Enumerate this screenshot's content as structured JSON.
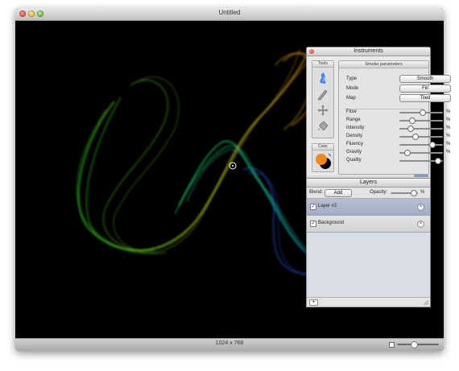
{
  "window": {
    "title": "Untitled"
  },
  "statusbar": {
    "canvas_size": "1024 x 768",
    "zoom_level": 0.4
  },
  "instruments": {
    "title": "Instruments",
    "tools_header": "Tools",
    "tools": [
      {
        "icon": "smoke-brush-icon"
      },
      {
        "icon": "pencil-icon"
      },
      {
        "icon": "move-icon"
      },
      {
        "icon": "bucket-icon"
      }
    ],
    "color_header": "Color",
    "color": {
      "foreground": "#f08a1e",
      "background": "#000000"
    },
    "smoke_header": "Smoke parameters",
    "params": [
      {
        "label": "Type",
        "value": "Smooth"
      },
      {
        "label": "Mode",
        "value": "Fill"
      },
      {
        "label": "Map",
        "value": "Tiled"
      }
    ],
    "sliders": [
      {
        "label": "Flow",
        "value": 0.55,
        "unit": "%"
      },
      {
        "label": "Range",
        "value": 0.25,
        "unit": "%"
      },
      {
        "label": "Intensity",
        "value": 0.22,
        "unit": "%"
      },
      {
        "label": "Density",
        "value": 0.35,
        "unit": "%"
      },
      {
        "label": "Fluency",
        "value": 0.8,
        "unit": "%"
      },
      {
        "label": "Gravity",
        "value": 0.12,
        "unit": "%"
      },
      {
        "label": "Quality",
        "value": 0.96,
        "unit": ""
      }
    ]
  },
  "layers": {
    "title": "Layers",
    "blend_label": "Blend:",
    "blend_value": "Add",
    "opacity_label": "Opacity:",
    "opacity_value": 0.96,
    "opacity_unit": "%",
    "items": [
      {
        "name": "Layer #2",
        "visible": true,
        "selected": true
      },
      {
        "name": "Background",
        "visible": true,
        "selected": false
      }
    ],
    "add_label": "+"
  }
}
